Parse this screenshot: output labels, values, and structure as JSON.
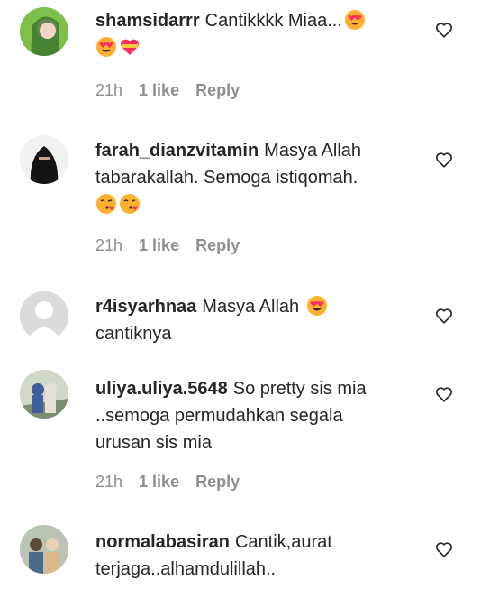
{
  "comments": [
    {
      "username": "shamsidarrr",
      "text": "Cantikkkk Miaa...",
      "emojis": [
        "heart-eyes-emoji",
        "heart-eyes-emoji",
        "heart-ribbon-emoji"
      ],
      "time": "21h",
      "likes": "1 like",
      "reply": "Reply"
    },
    {
      "username": "farah_dianzvitamin",
      "text": "Masya Allah tabarakallah. Semoga istiqomah.",
      "emojis": [
        "kissing-heart-emoji",
        "kissing-heart-emoji"
      ],
      "time": "21h",
      "likes": "1 like",
      "reply": "Reply"
    },
    {
      "username": "r4isyarhnaa",
      "text": "Masya Allah",
      "text_after": "cantiknya",
      "emojis": [
        "heart-eyes-emoji"
      ]
    },
    {
      "username": "uliya.uliya.5648",
      "text": "So pretty sis mia ..semoga permudahkan segala urusan sis mia",
      "time": "21h",
      "likes": "1 like",
      "reply": "Reply"
    },
    {
      "username": "normalabasiran",
      "text": "Cantik,aurat terjaga..alhamdulillah.."
    }
  ],
  "icons": {
    "like": "heart-outline-icon",
    "emoji_heart_eyes": "heart-eyes-emoji",
    "emoji_kiss": "kissing-heart-emoji",
    "emoji_heart_ribbon": "heart-ribbon-emoji"
  },
  "colors": {
    "text": "#262626",
    "meta": "#8e8e8e",
    "emoji_face": "#ffb02e",
    "emoji_heart": "#f92f60"
  }
}
